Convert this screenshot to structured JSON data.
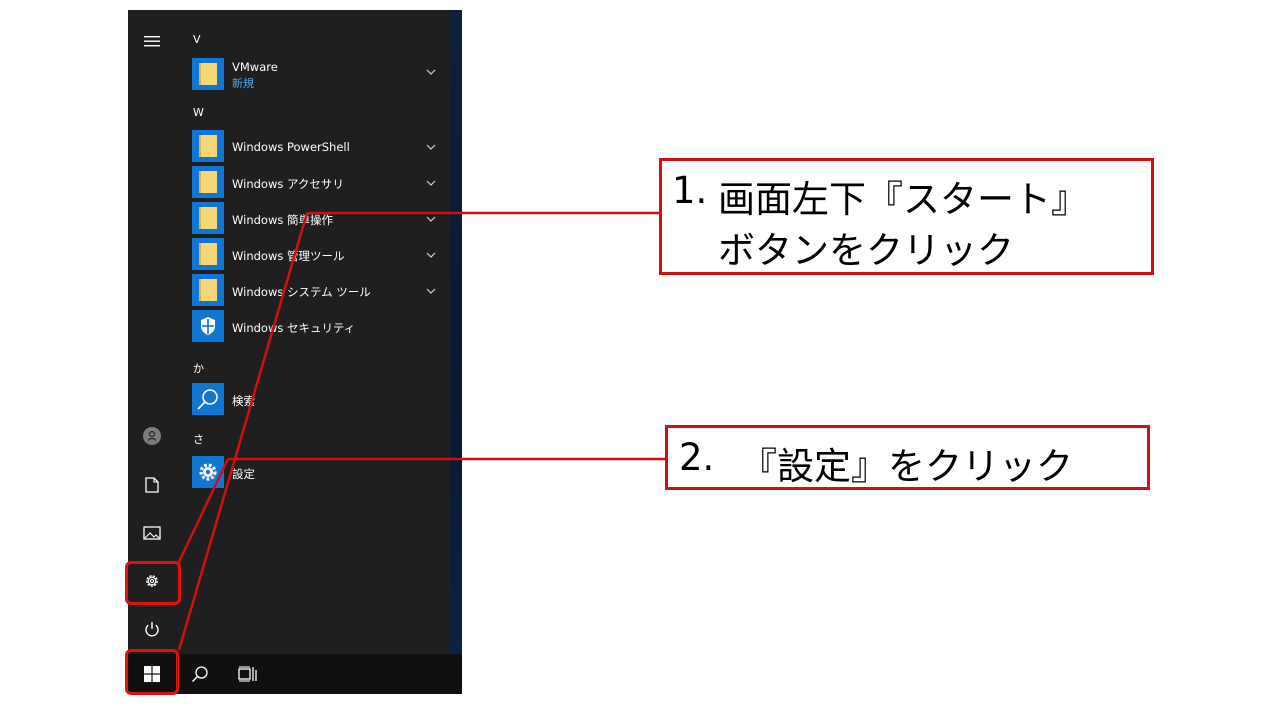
{
  "start_menu": {
    "sections": [
      {
        "letter": "V",
        "items": [
          {
            "label": "VMware",
            "sublabel": "新規",
            "icon": "folder-icon",
            "expandable": true
          }
        ]
      },
      {
        "letter": "W",
        "items": [
          {
            "label": "Windows PowerShell",
            "icon": "folder-icon",
            "expandable": true
          },
          {
            "label": "Windows アクセサリ",
            "icon": "folder-icon",
            "expandable": true
          },
          {
            "label": "Windows 簡単操作",
            "icon": "folder-icon",
            "expandable": true
          },
          {
            "label": "Windows 管理ツール",
            "icon": "folder-icon",
            "expandable": true
          },
          {
            "label": "Windows システム ツール",
            "icon": "folder-icon",
            "expandable": true
          },
          {
            "label": "Windows セキュリティ",
            "icon": "shield-icon",
            "expandable": false
          }
        ]
      },
      {
        "letter": "か",
        "items": [
          {
            "label": "検索",
            "icon": "search-icon",
            "expandable": false
          }
        ]
      },
      {
        "letter": "さ",
        "items": [
          {
            "label": "設定",
            "icon": "gear-icon",
            "expandable": false
          }
        ]
      }
    ],
    "left_rail_icons": [
      "hamburger-menu-icon",
      "user-avatar-icon",
      "documents-icon",
      "pictures-icon",
      "settings-gear-icon",
      "power-icon"
    ]
  },
  "taskbar": {
    "icons": [
      "windows-start-icon",
      "search-icon",
      "task-view-icon"
    ]
  },
  "callouts": [
    {
      "number": "1.",
      "line1": "画面左下『スタート』",
      "line2": "ボタンをクリック"
    },
    {
      "number": "2.",
      "line1": "『設定』をクリック"
    }
  ],
  "colors": {
    "accent_tile": "#1075d3",
    "highlight_red": "#e01010",
    "menu_bg": "#1f1f1f",
    "folder": "#f5d776"
  }
}
